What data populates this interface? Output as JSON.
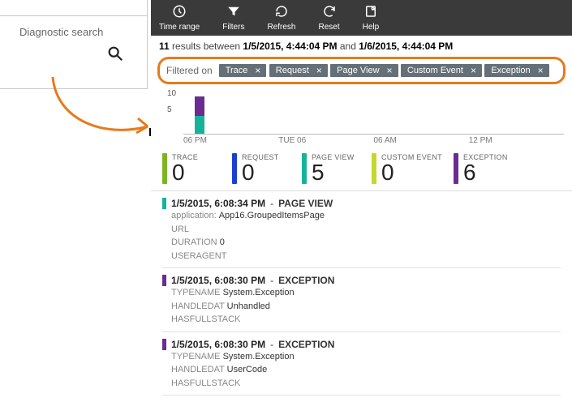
{
  "left": {
    "title": "Diagnostic search"
  },
  "toolbar": {
    "items": [
      {
        "id": "time-range",
        "label": "Time range"
      },
      {
        "id": "filters",
        "label": "Filters"
      },
      {
        "id": "refresh",
        "label": "Refresh"
      },
      {
        "id": "reset",
        "label": "Reset"
      },
      {
        "id": "help",
        "label": "Help"
      }
    ]
  },
  "summary": {
    "count": "11",
    "between": "results between",
    "start": "1/5/2015, 4:44:04 PM",
    "and": "and",
    "end": "1/6/2015, 4:44:04 PM"
  },
  "filters": {
    "label": "Filtered on",
    "chips": [
      "Trace",
      "Request",
      "Page View",
      "Custom Event",
      "Exception"
    ]
  },
  "chart_data": {
    "type": "bar",
    "ylim": [
      0,
      10
    ],
    "yticks": [
      5,
      10
    ],
    "xticks": [
      "06 PM",
      "TUE 06",
      "06 AM",
      "12 PM"
    ],
    "stacked": true,
    "series": [
      {
        "name": "Page View",
        "color": "#16b39a",
        "values": [
          5
        ]
      },
      {
        "name": "Exception",
        "color": "#6a2c91",
        "values": [
          6
        ]
      }
    ]
  },
  "stats": [
    {
      "label": "TRACE",
      "value": "0",
      "color": "#7db425"
    },
    {
      "label": "REQUEST",
      "value": "0",
      "color": "#1a3fd4"
    },
    {
      "label": "PAGE VIEW",
      "value": "5",
      "color": "#16b39a"
    },
    {
      "label": "CUSTOM EVENT",
      "value": "0",
      "color": "#c5d82b"
    },
    {
      "label": "EXCEPTION",
      "value": "6",
      "color": "#6a2c91"
    }
  ],
  "items": [
    {
      "color": "#16b39a",
      "time": "1/5/2015, 6:08:34 PM",
      "type": "PAGE VIEW",
      "lines": [
        {
          "k": "application:",
          "v": "App16.GroupedItemsPage",
          "mono": true
        },
        {
          "k": "URL",
          "v": ""
        },
        {
          "k": "DURATION",
          "v": "0"
        },
        {
          "k": "USERAGENT",
          "v": ""
        }
      ]
    },
    {
      "color": "#6a2c91",
      "time": "1/5/2015, 6:08:30 PM",
      "type": "EXCEPTION",
      "lines": [
        {
          "k": "TYPENAME",
          "v": "System.Exception"
        },
        {
          "k": "HANDLEDAT",
          "v": "Unhandled"
        },
        {
          "k": "HASFULLSTACK",
          "v": ""
        }
      ]
    },
    {
      "color": "#6a2c91",
      "time": "1/5/2015, 6:08:30 PM",
      "type": "EXCEPTION",
      "lines": [
        {
          "k": "TYPENAME",
          "v": "System.Exception"
        },
        {
          "k": "HANDLEDAT",
          "v": "UserCode"
        },
        {
          "k": "HASFULLSTACK",
          "v": ""
        }
      ]
    }
  ]
}
